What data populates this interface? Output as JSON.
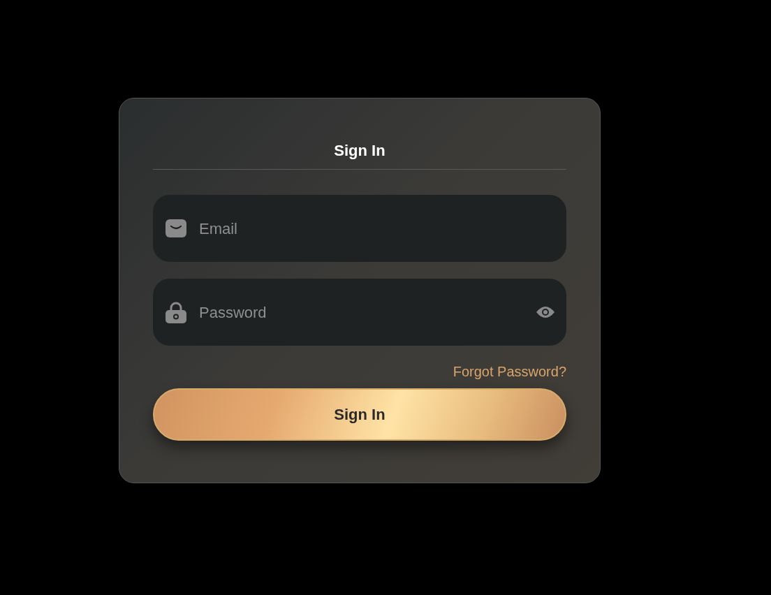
{
  "title": "Sign In",
  "fields": [
    {
      "kind": "email",
      "placeholder": "Email"
    },
    {
      "kind": "password",
      "placeholder": "Password"
    }
  ],
  "forgot_link": "Forgot Password?",
  "submit_button": "Sign In"
}
